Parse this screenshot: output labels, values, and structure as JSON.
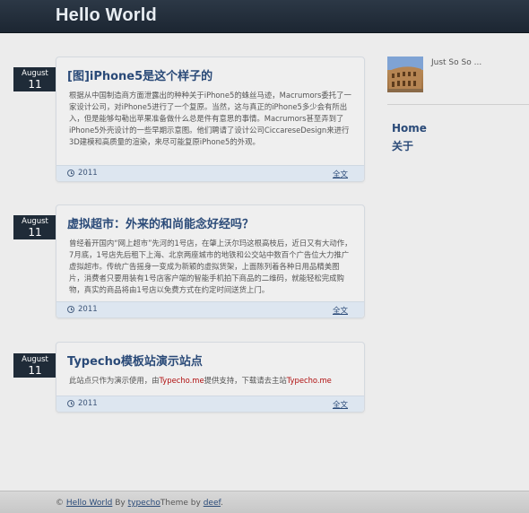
{
  "header": {
    "site_title": "Hello World"
  },
  "posts": [
    {
      "month": "August",
      "day": "11",
      "title": "[图]iPhone5是这个样子的",
      "excerpt": "根据从中国制造商方面泄露出的种种关于iPhone5的蛛丝马迹，Macrumors委托了一家设计公司，对iPhone5进行了一个复原。当然，这与真正的iPhone5多少会有所出入，但是能够勾勒出苹果准备做什么总是件有意思的事情。Macrumors甚至弄到了iPhone5外壳设计的一些早期示意图。他们聘请了设计公司CiccareseDesign来进行3D建模和高质量的渲染，来尽可能复原iPhone5的外观。",
      "year": "2011",
      "read_more": "全文"
    },
    {
      "month": "August",
      "day": "11",
      "title": "虚拟超市：外来的和尚能念好经吗？",
      "excerpt": "曾经着开国内“网上超市”先河的1号店，在肇上沃尔玛这根高枝后，近日又有大动作，7月底，1号店先后租下上海、北京两座城市的地铁和公交站中数百个广告位大力推广虚拟超市。传统广告摇身一变成为新颖的虚拟货架，上面陈列着各种日用品精美图片，消费者只要用装有1号店客户端的智能手机拍下商品的二维码，就能轻松完成购物，真实的商品将由1号店以免费方式在约定时间送货上门。",
      "year": "2011",
      "read_more": "全文"
    },
    {
      "month": "August",
      "day": "11",
      "title": "Typecho模板站演示站点",
      "excerpt_prefix": "此站点只作为演示使用，由",
      "excerpt_link1": "Typecho.me",
      "excerpt_middle": "提供支持，下载请去主站",
      "excerpt_link2": "Typecho.me",
      "year": "2011",
      "read_more": "全文"
    }
  ],
  "sidebar": {
    "tagline": "Just So So ...",
    "nav": [
      "Home",
      "关于"
    ]
  },
  "footer": {
    "copyright": "©",
    "site_link": "Hello World",
    "by": "By",
    "typecho_link": "typecho",
    "theme_by": "Theme by",
    "author_link": "deef",
    "end": "."
  },
  "colors": {
    "header_bg": "#1f2b38",
    "link": "#2a4a78",
    "highlight": "#b01010",
    "footer_strip": "#dde6f0"
  }
}
